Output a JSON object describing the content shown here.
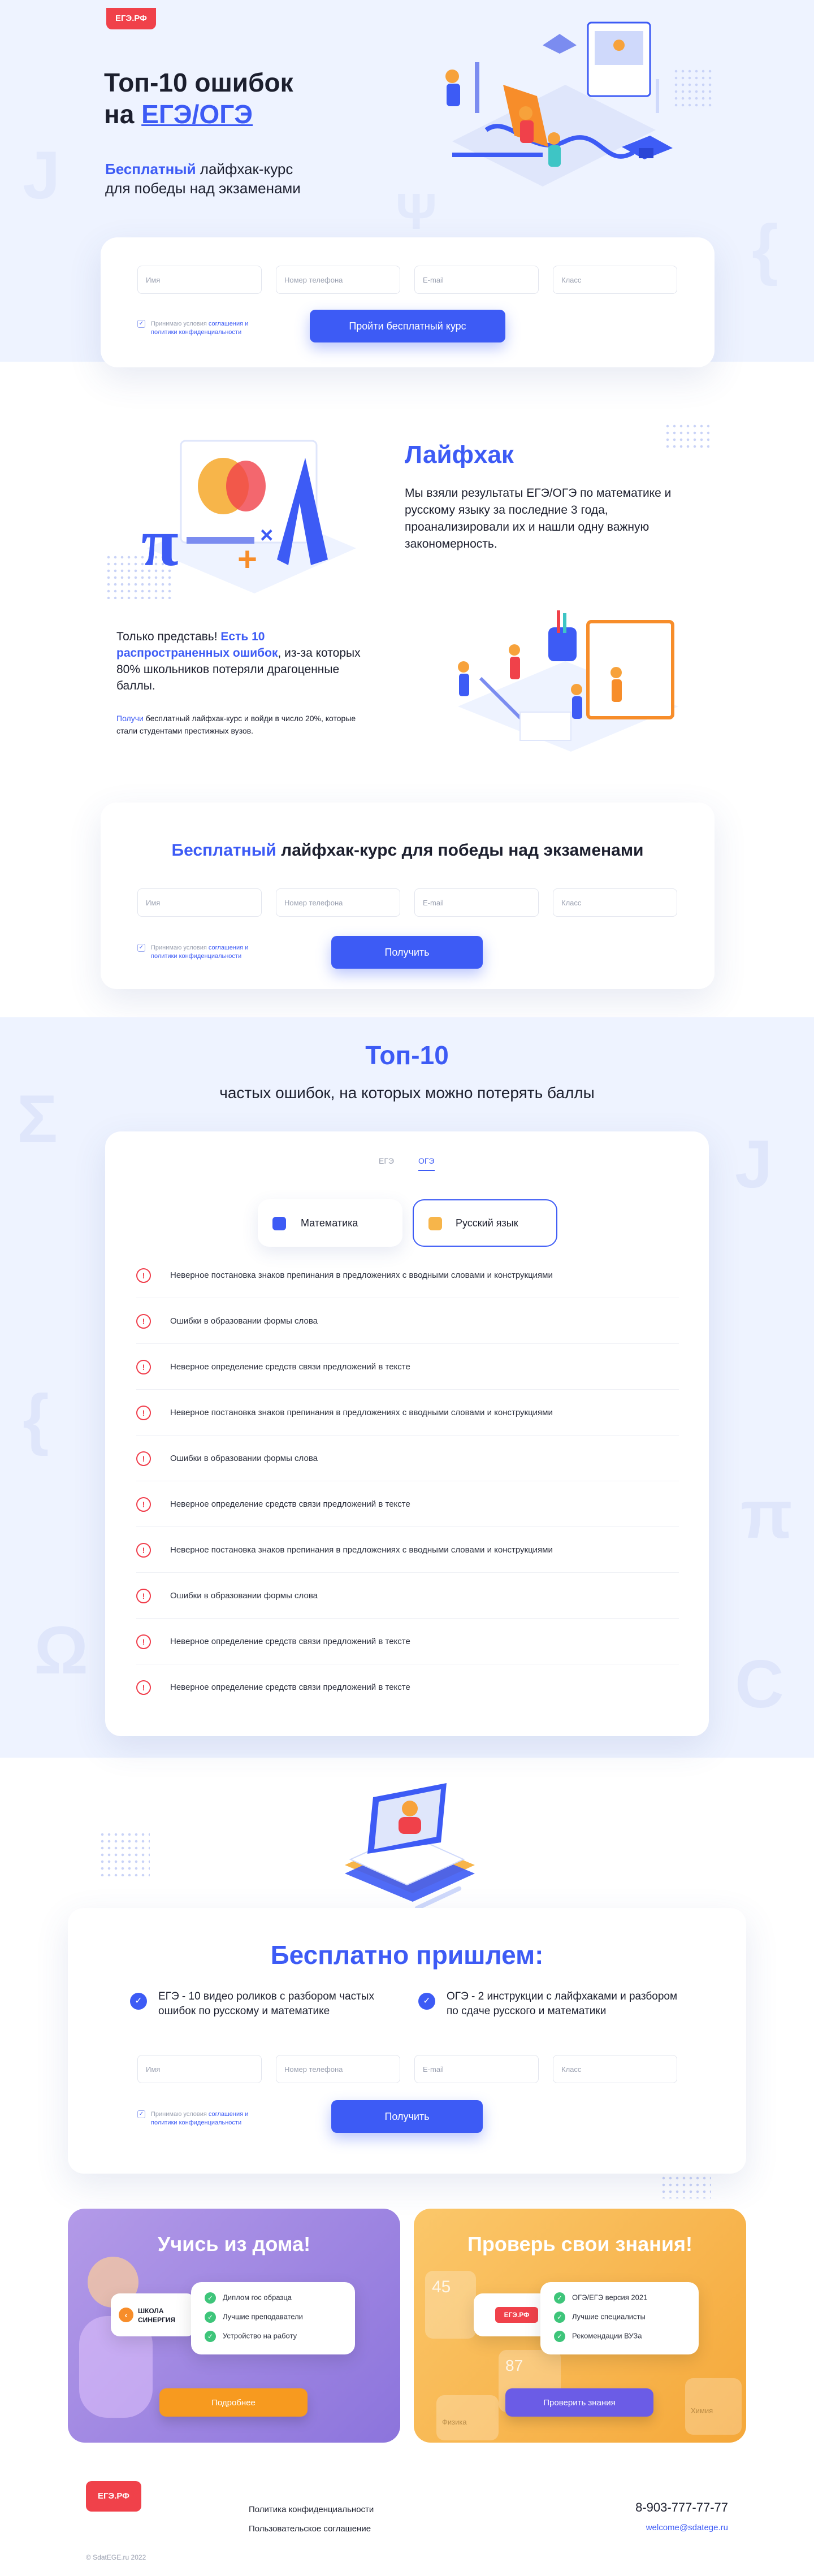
{
  "logo": "ЕГЭ.РФ",
  "hero": {
    "title_line1": "Топ-10 ошибок",
    "title_prefix": "на ",
    "title_highlight": "ЕГЭ/ОГЭ",
    "subtitle_highlight": "Бесплатный",
    "subtitle_rest": " лайфхак-курс",
    "subtitle_line2": "для победы над экзаменами"
  },
  "form1": {
    "name_placeholder": "Имя",
    "phone_placeholder": "Номер телефона",
    "email_placeholder": "E-mail",
    "class_placeholder": "Класс",
    "agree_prefix": "Принимаю условия ",
    "agree_link": "соглашения и политики конфиденциальности",
    "button": "Пройти бесплатный курс"
  },
  "lifehack": {
    "title": "Лайфхак",
    "text": "Мы взяли результаты ЕГЭ/ОГЭ по математике и русскому языку за последние 3 года, проанализировали их и нашли одну важную закономерность.",
    "imagine_prefix": "Только представь! ",
    "imagine_highlight": "Есть 10 распространенных ошибок",
    "imagine_rest": ", из-за которых 80% школьников потеряли драгоценные баллы.",
    "small_highlight": "Получи",
    "small_rest": " бесплатный лайфхак-курс и войди в число 20%, которые стали студентами престижных вузов."
  },
  "form2": {
    "title_highlight": "Бесплатный",
    "title_rest": " лайфхак-курс для победы над экзаменами",
    "name_placeholder": "Имя",
    "phone_placeholder": "Номер телефона",
    "email_placeholder": "E-mail",
    "class_placeholder": "Класс",
    "agree_prefix": "Принимаю условия ",
    "agree_link": "соглашения и политики конфиденциальности",
    "button": "Получить"
  },
  "top10": {
    "title": "Топ-10",
    "subtitle": "частых ошибок, на которых можно потерять баллы",
    "tab_ege": "ЕГЭ",
    "tab_oge": "ОГЭ",
    "subject_math": "Математика",
    "subject_rus": "Русский язык",
    "errors": [
      "Неверное постановка знаков препинания в предложениях с вводными словами и конструкциями",
      "Ошибки в образовании формы слова",
      "Неверное определение средств связи предложений в тексте",
      "Неверное постановка знаков препинания в предложениях с вводными словами и конструкциями",
      "Ошибки в образовании формы слова",
      "Неверное определение средств связи предложений в тексте",
      "Неверное постановка знаков препинания в предложениях с вводными словами и конструкциями",
      "Ошибки в образовании формы слова",
      "Неверное определение средств связи предложений в тексте",
      "Неверное определение средств связи предложений в тексте"
    ]
  },
  "free": {
    "title": "Бесплатно пришлем:",
    "item1": "ЕГЭ - 10 видео роликов с разбором частых ошибок по русскому и математике",
    "item2": "ОГЭ - 2 инструкции с лайфхаками и разбором по сдаче русского и математики",
    "name_placeholder": "Имя",
    "phone_placeholder": "Номер телефона",
    "email_placeholder": "E-mail",
    "class_placeholder": "Класс",
    "agree_prefix": "Принимаю условия ",
    "agree_link": "соглашения и политики конфиденциальности",
    "button": "Получить"
  },
  "promo_left": {
    "title": "Учись из дома!",
    "school_line1": "ШКОЛА",
    "school_line2": "СИНЕРГИЯ",
    "items": [
      "Диплом гос образца",
      "Лучшие преподаватели",
      "Устройство на работу"
    ],
    "button": "Подробнее",
    "color": "#a68be8"
  },
  "promo_right": {
    "title": "Проверь свои знания!",
    "logo": "ЕГЭ.РФ",
    "items": [
      "ОГЭ/ЕГЭ версия 2021",
      "Лучшие специалисты",
      "Рекомендации ВУЗа"
    ],
    "button": "Проверить знания",
    "bg_words": [
      "45",
      "87",
      "Физика",
      "Химия"
    ],
    "color": "#f7b54a"
  },
  "footer": {
    "logo": "ЕГЭ.РФ",
    "privacy": "Политика конфиденциальности",
    "agreement": "Пользовательское соглашение",
    "phone": "8-903-777-77-77",
    "email": "welcome@sdatege.ru",
    "copyright": "© SdatEGE.ru 2022"
  },
  "colors": {
    "accent": "#3d5bf5",
    "error": "#f03c4a",
    "success": "#3ec57a",
    "bg_light": "#eef3ff"
  }
}
